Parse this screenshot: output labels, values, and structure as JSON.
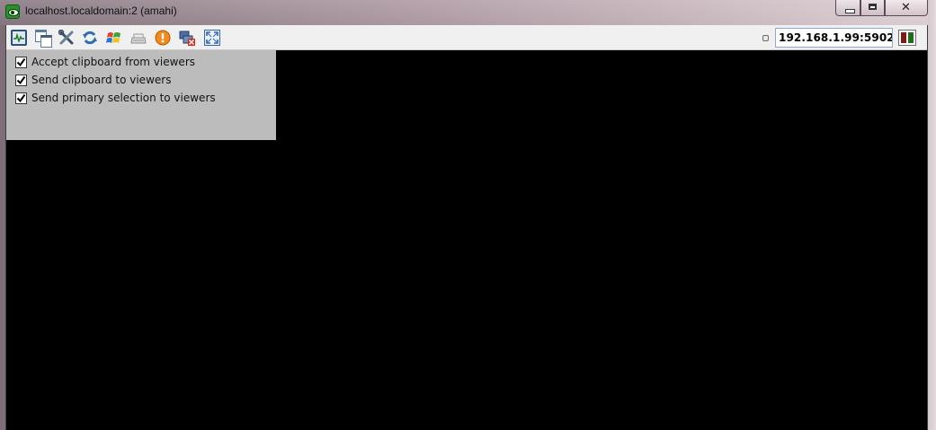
{
  "window": {
    "title": "localhost.localdomain:2 (amahi)"
  },
  "titlebar_buttons": {
    "minimize": "minimize",
    "maximize": "maximize",
    "close": "close"
  },
  "toolbar": {
    "icons": [
      "monitor-activity-icon",
      "windows-icon",
      "tools-icon",
      "refresh-icon",
      "windows-flag-icon",
      "keyboard-icon",
      "alert-icon",
      "disconnect-icon",
      "fullscreen-icon"
    ],
    "address": "192.168.1.99:5902",
    "status_icon": "connection-status-icon"
  },
  "clipboard_options": [
    {
      "label": "Accept clipboard from viewers",
      "checked": true
    },
    {
      "label": "Send clipboard to viewers",
      "checked": true
    },
    {
      "label": "Send primary selection to viewers",
      "checked": true
    }
  ],
  "colors": {
    "remote_desktop": "#000000",
    "panel": "#bcbcbc",
    "toolbar": "#f0f0f0"
  }
}
